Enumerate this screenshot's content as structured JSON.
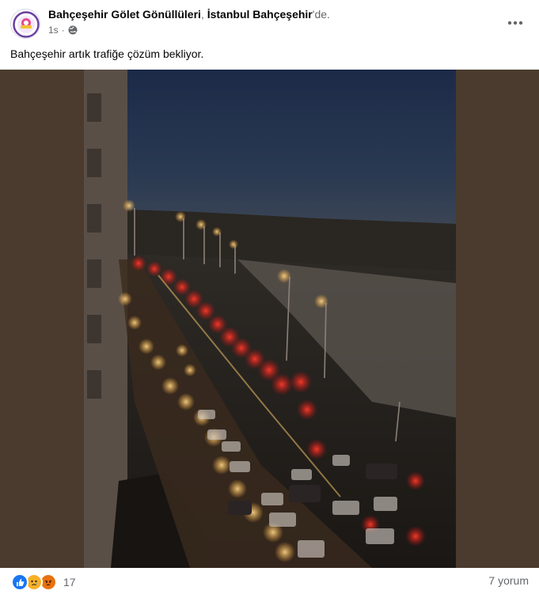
{
  "post": {
    "author": "Bahçeşehir Gölet Gönüllüleri",
    "separator": ", ",
    "location": "İstanbul Bahçeşehir",
    "location_suffix": "'de.",
    "time": "1s",
    "privacy_icon": "globe-icon",
    "caption": "Bahçeşehir artık trafiğe çözüm bekliyor.",
    "more_icon": "ellipsis-icon"
  },
  "footer": {
    "reaction_icons": [
      "like-icon",
      "sad-icon",
      "angry-icon"
    ],
    "reaction_count": "17",
    "comments": "7 yorum"
  },
  "colors": {
    "like": "#1877f2",
    "sad": "#f7b125",
    "angry": "#e9710f",
    "media_background": "#4a3b2e"
  }
}
